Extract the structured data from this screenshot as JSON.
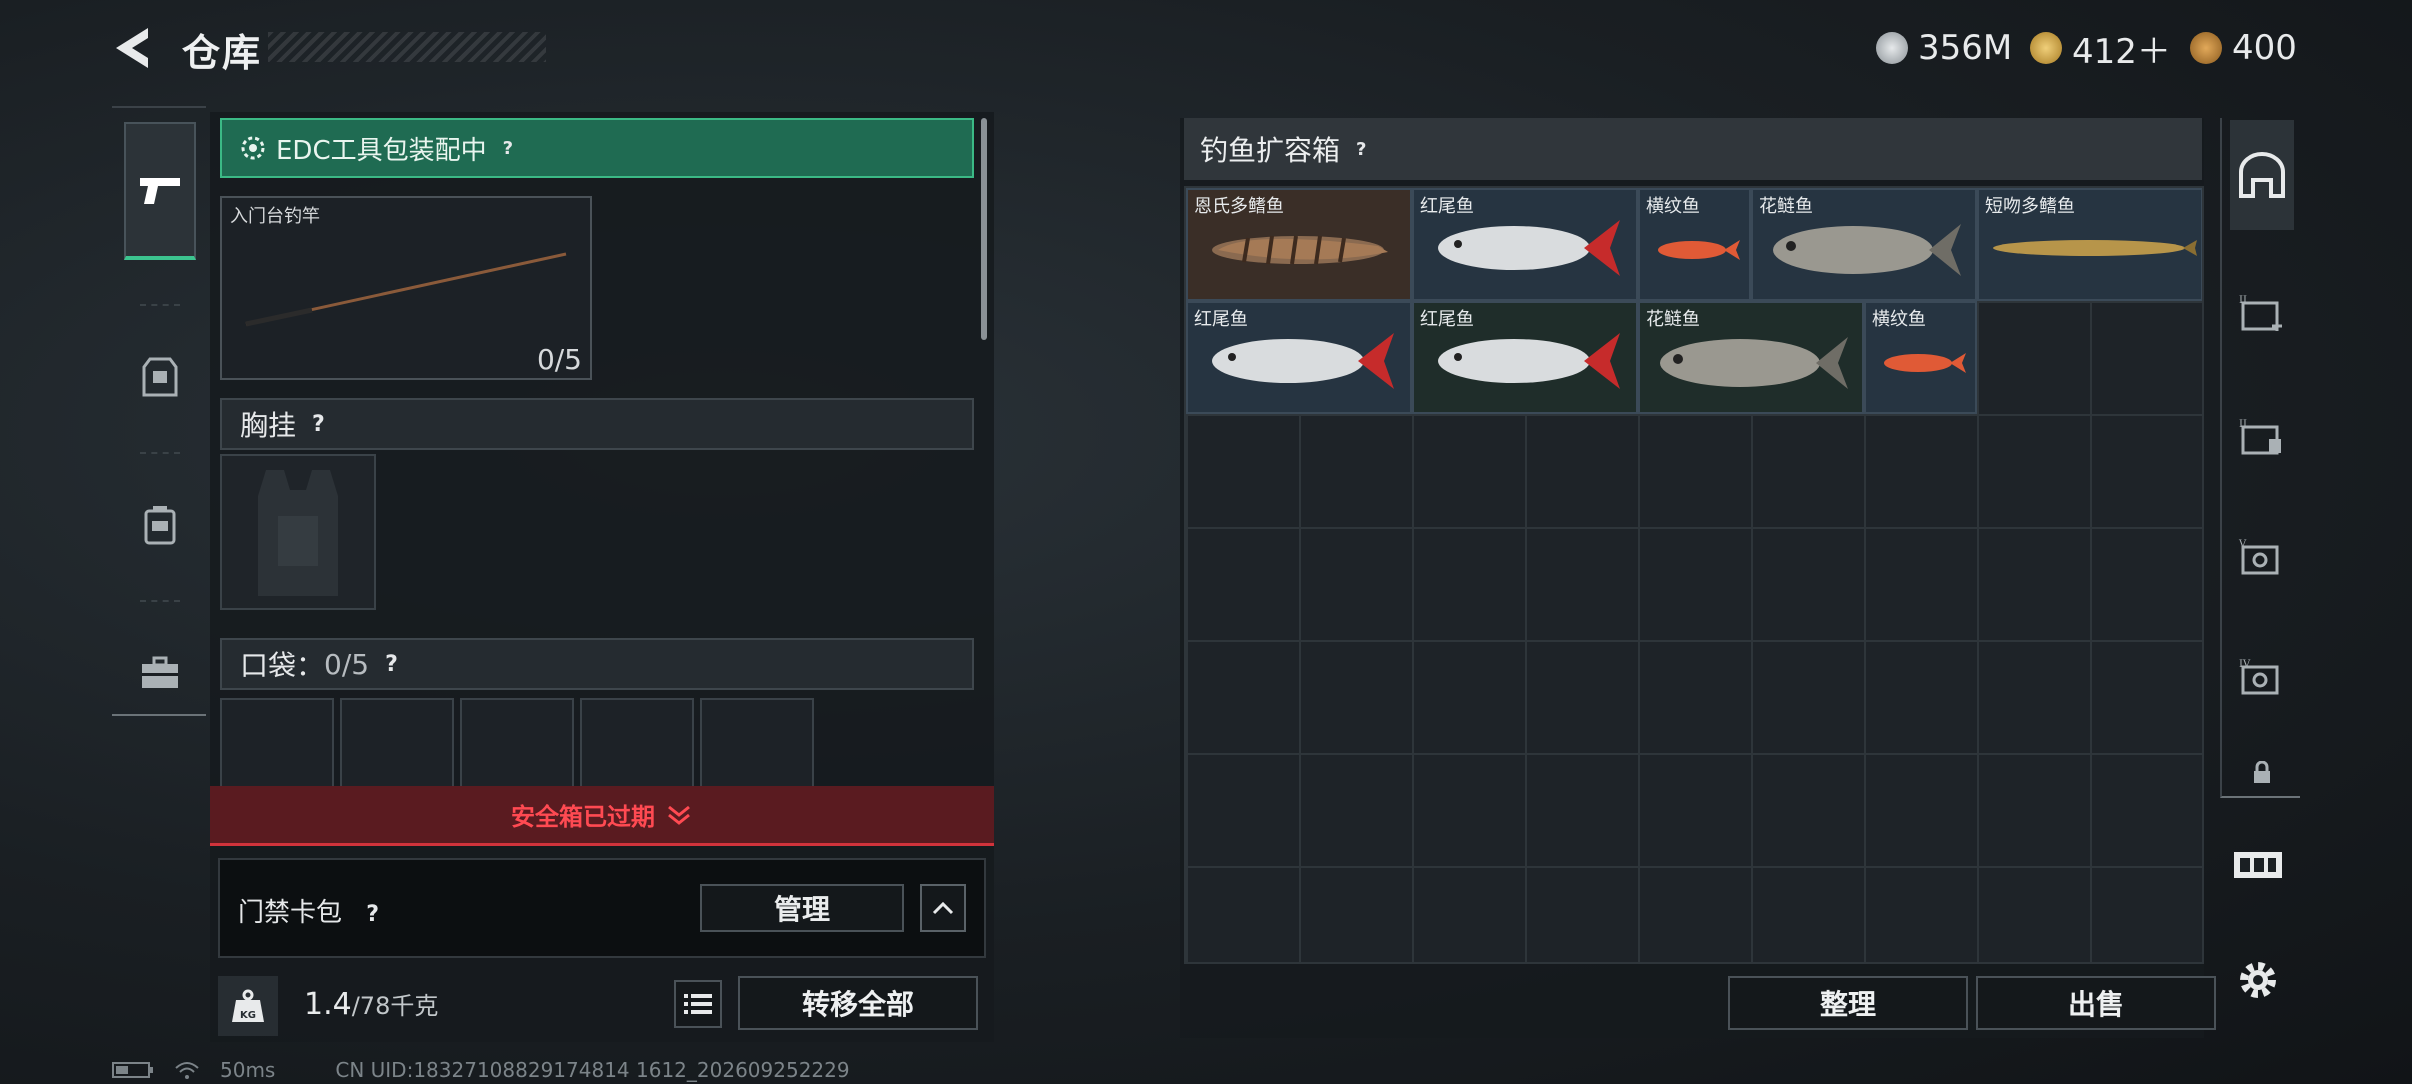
{
  "header": {
    "title": "仓库",
    "currencies": [
      {
        "icon": "silver-coin-icon",
        "value": "356M",
        "color": "#c9cdd0"
      },
      {
        "icon": "gold-triangle-coin-icon",
        "value": "412＋",
        "color": "#d4a94a"
      },
      {
        "icon": "bronze-coin-icon",
        "value": "400",
        "color": "#c48a3a"
      }
    ]
  },
  "left_nav": {
    "items": [
      {
        "icon": "pistol-icon",
        "active": true
      },
      {
        "icon": "armor-icon",
        "active": false
      },
      {
        "icon": "backpack-icon",
        "active": false
      },
      {
        "icon": "toolbox-icon",
        "active": false
      }
    ]
  },
  "loadout": {
    "edc_status": "EDC工具包装配中",
    "edc_help": "?",
    "rod_name": "入门台钓竿",
    "rod_count": "0/5",
    "chest_label": "胸挂",
    "chest_help": "?",
    "pocket_label": "口袋：",
    "pocket_count": "0/5",
    "pocket_help": "?",
    "safebox_expired": "安全箱已过期",
    "card_pack_label": "门禁卡包",
    "card_pack_help": "?",
    "manage_label": "管理",
    "weight_current": "1.4",
    "weight_max": "/78千克",
    "kg_label": "KG",
    "transfer_all": "转移全部"
  },
  "storage": {
    "title": "钓鱼扩容箱",
    "help": "?",
    "fish": [
      {
        "name": "恩氏多鳍鱼",
        "bg": "#3a2e27"
      },
      {
        "name": "红尾鱼",
        "bg": "#263441"
      },
      {
        "name": "横纹鱼",
        "bg": "#263441"
      },
      {
        "name": "花鲢鱼",
        "bg": "#263441"
      },
      {
        "name": "短吻多鳍鱼",
        "bg": "#263441"
      },
      {
        "name": "红尾鱼",
        "bg": "#263441"
      },
      {
        "name": "红尾鱼",
        "bg": "#1f2d2a"
      },
      {
        "name": "花鲢鱼",
        "bg": "#1f2d2a"
      },
      {
        "name": "横纹鱼",
        "bg": "#263441"
      }
    ],
    "sort_label": "整理",
    "sell_label": "出售"
  },
  "right_nav": {
    "items": [
      {
        "icon": "storage-home-icon"
      },
      {
        "icon": "expansion-box-ii-plus-icon"
      },
      {
        "icon": "expansion-box-ii-icon"
      },
      {
        "icon": "expansion-box-v-icon"
      },
      {
        "icon": "expansion-box-iv-icon"
      },
      {
        "icon": "lock-icon"
      },
      {
        "icon": "special-box-icon"
      },
      {
        "icon": "gear-icon"
      }
    ]
  },
  "footer": {
    "ping": "50ms",
    "uid": "CN UID:18327108829174814 1612_202609252229"
  }
}
